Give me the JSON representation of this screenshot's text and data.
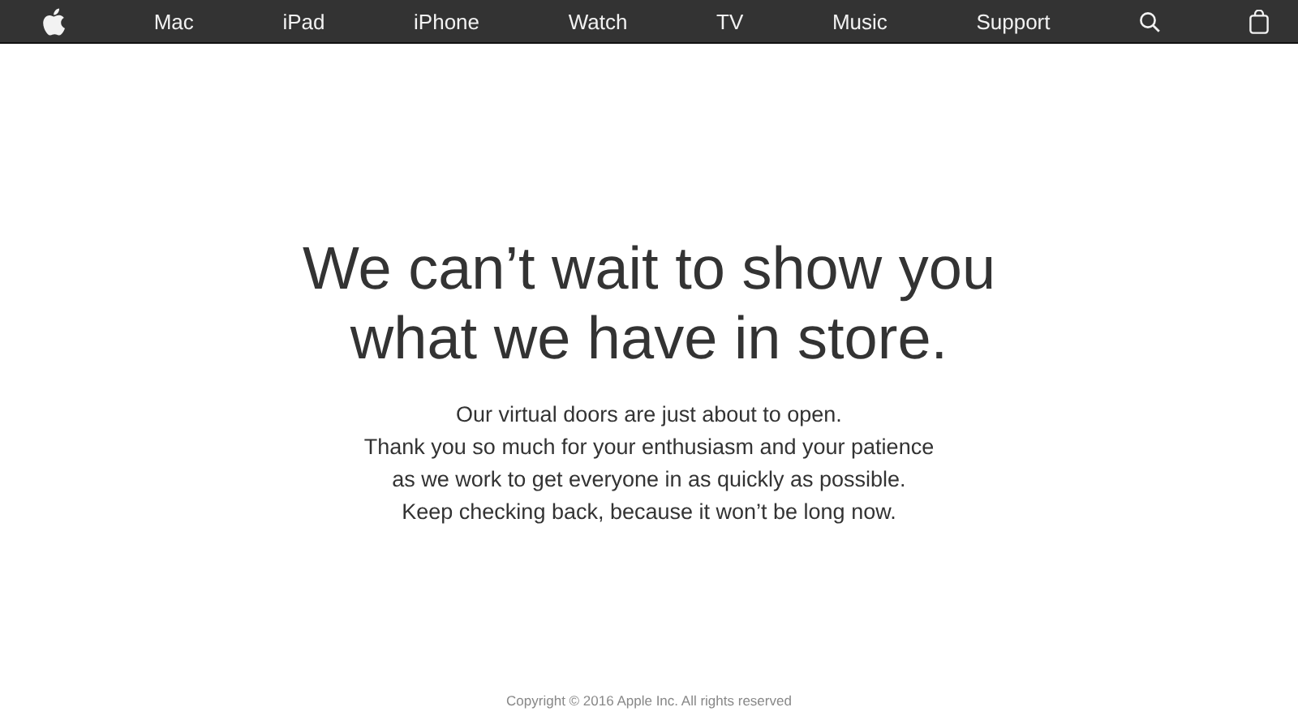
{
  "nav": {
    "items": [
      {
        "label": "Mac"
      },
      {
        "label": "iPad"
      },
      {
        "label": "iPhone"
      },
      {
        "label": "Watch"
      },
      {
        "label": "TV"
      },
      {
        "label": "Music"
      },
      {
        "label": "Support"
      }
    ]
  },
  "headline": [
    "We can’t wait to show you",
    "what we have in store."
  ],
  "message": [
    "Our virtual doors are just about to open.",
    "Thank you so much for your enthusiasm and your patience",
    "as we work to get everyone in as quickly as possible.",
    "Keep checking back, because it won’t be long now."
  ],
  "footer": "Copyright © 2016 Apple Inc. All rights reserved"
}
